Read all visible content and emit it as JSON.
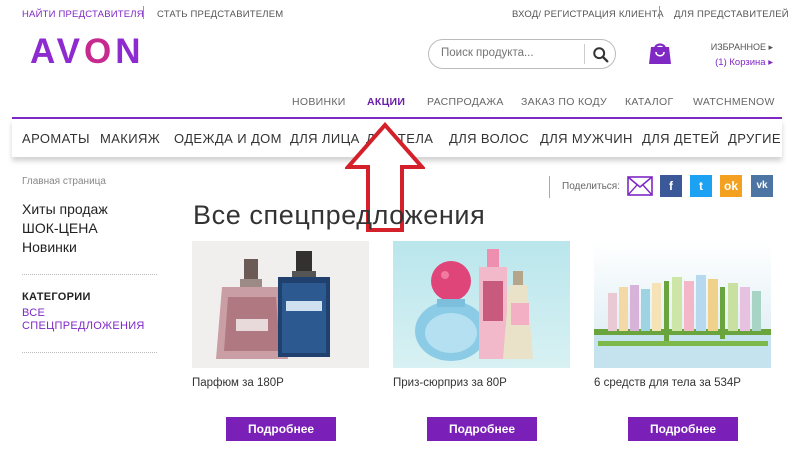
{
  "util_bar": {
    "find_rep": "НАЙТИ ПРЕДСТАВИТЕЛЯ",
    "become_rep": "СТАТЬ ПРЕДСТАВИТЕЛЕМ",
    "login": "ВХОД/ РЕГИСТРАЦИЯ КЛИЕНТА",
    "for_reps": "ДЛЯ ПРЕДСТАВИТЕЛЕЙ"
  },
  "brand": {
    "logo_left": "AV",
    "logo_o": "O",
    "logo_n": "N",
    "color": "#8e2bd0",
    "accent": "#c72a8f"
  },
  "search": {
    "placeholder": "Поиск продукта..."
  },
  "account": {
    "favorites": "ИЗБРАННОЕ ▸",
    "cart": "(1) Корзина ▸"
  },
  "subnav": [
    {
      "label": "НОВИНКИ"
    },
    {
      "label": "АКЦИИ",
      "active": true
    },
    {
      "label": "РАСПРОДАЖА"
    },
    {
      "label": "ЗАКАЗ ПО КОДУ"
    },
    {
      "label": "КАТАЛОГ"
    },
    {
      "label": "WATCHMENOW"
    }
  ],
  "catnav": [
    {
      "label": "АРОМАТЫ"
    },
    {
      "label": "МАКИЯЖ"
    },
    {
      "label": "ОДЕЖДА И ДОМ"
    },
    {
      "label": "ДЛЯ ЛИЦА"
    },
    {
      "label": "ДЛЯ ТЕЛА"
    },
    {
      "label": "ДЛЯ ВОЛОС"
    },
    {
      "label": "ДЛЯ МУЖЧИН"
    },
    {
      "label": "ДЛЯ ДЕТЕЙ"
    },
    {
      "label": "ДРУГИЕ"
    }
  ],
  "sidebar": {
    "breadcrumb": "Главная страница",
    "links": [
      "Хиты продаж",
      "ШОК-ЦЕНА",
      "Новинки"
    ],
    "categories_label": "КАТЕГОРИИ",
    "category_link_line1": "ВСЕ",
    "category_link_line2": "СПЕЦПРЕДЛОЖЕНИЯ"
  },
  "share": {
    "label": "Поделиться:",
    "icons": [
      "mail-icon",
      "facebook-icon",
      "twitter-icon",
      "odnoklassniki-icon",
      "vk-icon"
    ],
    "fb": "f",
    "tw": "t",
    "ok": "ok",
    "vk": "vk"
  },
  "main": {
    "heading": "Все спецпредложения",
    "cards": [
      {
        "title": "Парфюм за 180Р",
        "button": "Подробнее"
      },
      {
        "title": "Приз-сюрприз за 80Р",
        "button": "Подробнее"
      },
      {
        "title": "6 средств для тела за 534Р",
        "button": "Подробнее"
      }
    ]
  },
  "colors": {
    "purple": "#7f28c4",
    "button": "#7a1fb8",
    "arrow": "#d4202a"
  }
}
